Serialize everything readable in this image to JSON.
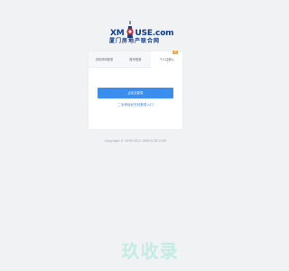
{
  "logo": {
    "letters_left": "XM",
    "letters_right": "USE.com",
    "subtitle": "厦门房地产联合网"
  },
  "tabs": [
    {
      "label": "手机号码登录",
      "active": false
    },
    {
      "label": "账号登录",
      "active": false
    },
    {
      "label": "个人注册入",
      "active": true,
      "badge": "新"
    }
  ],
  "login_button": "点击去登录",
  "qr_link": "二手房经纪在线登录入口",
  "copyright": "Copyright © 1999-2022 XMHOUSE.COM",
  "watermark": "玖收录",
  "colors": {
    "brand": "#123c8f",
    "accent": "#3b8ef0",
    "badge": "#f4a23c"
  }
}
